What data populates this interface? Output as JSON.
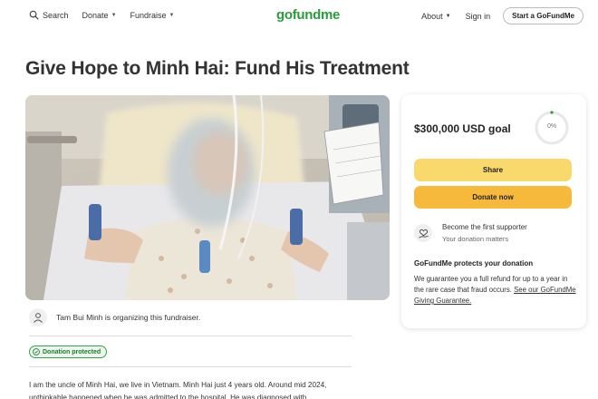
{
  "nav": {
    "search_label": "Search",
    "donate_label": "Donate",
    "fundraise_label": "Fundraise",
    "logo_text": "gofundme",
    "about_label": "About",
    "signin_label": "Sign in",
    "start_label": "Start a GoFundMe"
  },
  "campaign": {
    "title": "Give Hope to Minh Hai: Fund His Treatment",
    "organizer_text": "Tam Bui Minh is organizing this fundraiser.",
    "badge_label": "Donation protected",
    "story": "I am the uncle of Minh Hai, we live in Vietnam. Minh Hai just 4 years old. Around mid 2024, unthinkable happened when he was admitted to the hospital. He was diagnosed with"
  },
  "donation_card": {
    "goal_text": "$300,000 USD goal",
    "progress_label": "0%",
    "progress_fraction": 0,
    "share_label": "Share",
    "donate_label": "Donate now",
    "supporter_title": "Become the first supporter",
    "supporter_sub": "Your donation matters",
    "protect_title": "GoFundMe protects your donation",
    "protect_text": "We guarantee you a full refund for up to a year in the rare case that fraud occurs.",
    "protect_link": "See our GoFundMe Giving Guarantee."
  },
  "colors": {
    "brand_green": "#2a9d3b",
    "share_button": "#f9d96b",
    "donate_button": "#f6b93b",
    "badge_green": "#3aa14f"
  }
}
